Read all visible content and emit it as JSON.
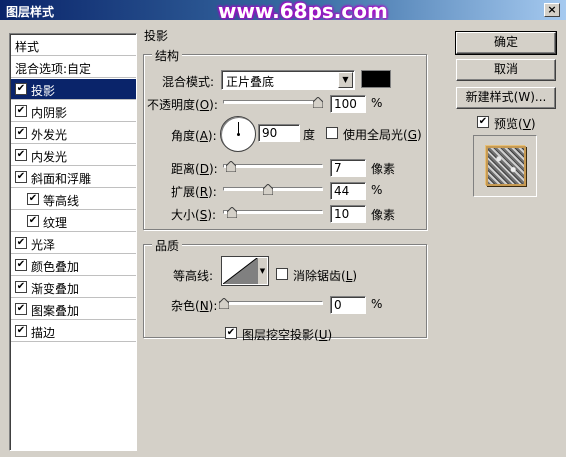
{
  "window": {
    "title": "图层样式",
    "watermark": "www.68ps.com",
    "close_glyph": "×"
  },
  "sidebar": {
    "header": "样式",
    "items": [
      {
        "label": "混合选项:自定",
        "checked": null,
        "indent": 0
      },
      {
        "label": "投影",
        "checked": true,
        "indent": 0,
        "selected": true
      },
      {
        "label": "内阴影",
        "checked": true,
        "indent": 0
      },
      {
        "label": "外发光",
        "checked": true,
        "indent": 0
      },
      {
        "label": "内发光",
        "checked": true,
        "indent": 0
      },
      {
        "label": "斜面和浮雕",
        "checked": true,
        "indent": 0
      },
      {
        "label": "等高线",
        "checked": true,
        "indent": 1
      },
      {
        "label": "纹理",
        "checked": true,
        "indent": 1
      },
      {
        "label": "光泽",
        "checked": true,
        "indent": 0
      },
      {
        "label": "颜色叠加",
        "checked": true,
        "indent": 0
      },
      {
        "label": "渐变叠加",
        "checked": true,
        "indent": 0
      },
      {
        "label": "图案叠加",
        "checked": true,
        "indent": 0
      },
      {
        "label": "描边",
        "checked": true,
        "indent": 0
      }
    ]
  },
  "panel": {
    "title": "投影",
    "structure": {
      "title": "结构",
      "blend_mode_label": "混合模式:",
      "blend_mode_value": "正片叠底",
      "shadow_color": "#000000",
      "opacity_label_pre": "不透明度(",
      "opacity_key": "O",
      "opacity_label_post": "):",
      "opacity_value": "100",
      "opacity_unit": "%",
      "opacity_level": 1.0,
      "angle_label_pre": "角度(",
      "angle_key": "A",
      "angle_label_post": "):",
      "angle_value": "90",
      "angle_unit": "度",
      "global_light_label_pre": "使用全局光(",
      "global_light_key": "G",
      "global_light_label_post": ")",
      "global_light_checked": false,
      "distance_label_pre": "距离(",
      "distance_key": "D",
      "distance_label_post": "):",
      "distance_value": "7",
      "distance_unit": "像素",
      "distance_level": 0.03,
      "spread_label_pre": "扩展(",
      "spread_key": "R",
      "spread_label_post": "):",
      "spread_value": "44",
      "spread_unit": "%",
      "spread_level": 0.44,
      "size_label_pre": "大小(",
      "size_key": "S",
      "size_label_post": "):",
      "size_value": "10",
      "size_unit": "像素",
      "size_level": 0.04
    },
    "quality": {
      "title": "品质",
      "contour_label": "等高线:",
      "antialias_label_pre": "消除锯齿(",
      "antialias_key": "L",
      "antialias_label_post": ")",
      "antialias_checked": false,
      "noise_label_pre": "杂色(",
      "noise_key": "N",
      "noise_label_post": "):",
      "noise_value": "0",
      "noise_unit": "%",
      "noise_level": 0.0
    },
    "knockout_label_pre": "图层挖空投影(",
    "knockout_key": "U",
    "knockout_label_post": ")",
    "knockout_checked": true
  },
  "buttons": {
    "ok": "确定",
    "cancel": "取消",
    "new_style": "新建样式(W)...",
    "preview_label_pre": "预览(",
    "preview_key": "V",
    "preview_label_post": ")",
    "preview_checked": true
  },
  "check_glyph": "✔"
}
